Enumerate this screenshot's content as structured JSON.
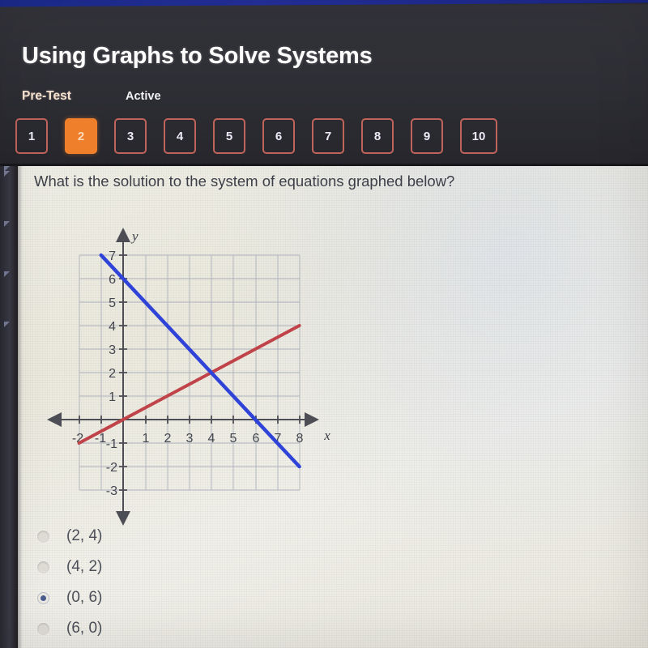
{
  "header": {
    "title": "Using Graphs to Solve Systems",
    "section_label": "Pre-Test",
    "status_label": "Active",
    "accent_color": "#f07f2b",
    "pill_border_color": "#c0635a",
    "pills": [
      {
        "label": "1",
        "current": false
      },
      {
        "label": "2",
        "current": true
      },
      {
        "label": "3",
        "current": false
      },
      {
        "label": "4",
        "current": false
      },
      {
        "label": "5",
        "current": false
      },
      {
        "label": "6",
        "current": false
      },
      {
        "label": "7",
        "current": false
      },
      {
        "label": "8",
        "current": false
      },
      {
        "label": "9",
        "current": false
      },
      {
        "label": "10",
        "current": false
      }
    ]
  },
  "question": {
    "text": "What is the solution to the system of equations graphed below?"
  },
  "options": [
    {
      "label": "(2, 4)",
      "selected": false
    },
    {
      "label": "(4, 2)",
      "selected": false
    },
    {
      "label": "(0, 6)",
      "selected": true
    },
    {
      "label": "(6, 0)",
      "selected": false
    }
  ],
  "chart_data": {
    "type": "line",
    "title": "",
    "xlabel": "x",
    "ylabel": "y",
    "xlim": [
      -2,
      8
    ],
    "ylim": [
      -3,
      7
    ],
    "xticks": [
      -2,
      -1,
      1,
      2,
      3,
      4,
      5,
      6,
      7,
      8
    ],
    "yticks": [
      -3,
      -2,
      -1,
      1,
      2,
      3,
      4,
      5,
      6,
      7
    ],
    "xtick_labels": [
      "-2",
      "-1",
      "1",
      "2",
      "3",
      "4",
      "5",
      "6",
      "7",
      "8"
    ],
    "ytick_labels": [
      "-3",
      "-2",
      "-1",
      "1",
      "2",
      "3",
      "4",
      "5",
      "6",
      "7"
    ],
    "grid": true,
    "legend": "none",
    "series": [
      {
        "name": "blue-line",
        "color": "#2f43d8",
        "equation": "y = -x + 6",
        "slope": -1,
        "intercept": 6,
        "x": [
          -1,
          8
        ],
        "y": [
          7,
          -2
        ]
      },
      {
        "name": "red-line",
        "color": "#c0434a",
        "equation": "y = 0.5x",
        "slope": 0.5,
        "intercept": 0,
        "x": [
          -2,
          8
        ],
        "y": [
          -1,
          4
        ]
      }
    ],
    "annotations": [
      {
        "name": "intersection",
        "x": 4,
        "y": 2,
        "label": ""
      }
    ]
  },
  "left_rail": {
    "marker_icon": "triangle-marker",
    "marker_count": 5
  }
}
